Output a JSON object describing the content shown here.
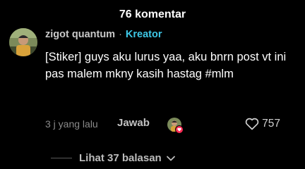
{
  "header": {
    "title": "76 komentar"
  },
  "comment": {
    "author": "zigot quantum",
    "separator": "·",
    "badge": "Kreator",
    "text": "[Stiker] guys aku lurus yaa, aku bnrn post vt ini pas malem mkny kasih hastag #mlm",
    "time": "3 j yang lalu",
    "reply_label": "Jawab",
    "likes": "757",
    "creator_liked_icon": "heart-badge-avatar"
  },
  "replies": {
    "label": "Lihat 37 balasan",
    "icon": "chevron-down-icon"
  },
  "colors": {
    "background": "#000000",
    "accent": "#3ec7e6",
    "badge_heart": "#fe2c55"
  }
}
